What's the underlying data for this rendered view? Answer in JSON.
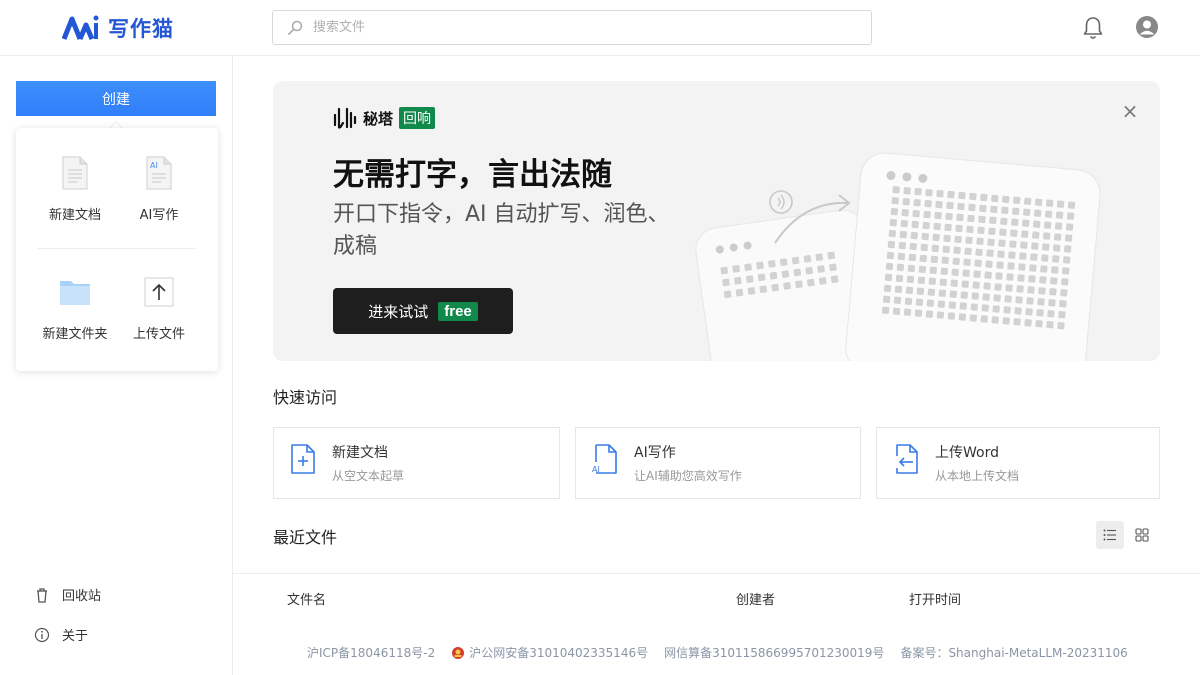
{
  "header": {
    "logo_text": "写作猫",
    "search_placeholder": "搜索文件",
    "icons": [
      "bell-icon",
      "user-icon"
    ]
  },
  "sidebar": {
    "create_label": "创建",
    "create_menu": [
      {
        "label": "新建文档",
        "icon": "document-icon"
      },
      {
        "label": "AI写作",
        "icon": "ai-document-icon"
      },
      {
        "label": "新建文件夹",
        "icon": "folder-icon"
      },
      {
        "label": "上传文件",
        "icon": "upload-icon"
      }
    ],
    "bottom": [
      {
        "label": "回收站",
        "icon": "trash-icon"
      },
      {
        "label": "关于",
        "icon": "info-icon"
      }
    ]
  },
  "banner": {
    "brand_name": "秘塔",
    "brand_tag": "回响",
    "title": "无需打字，言出法随",
    "subtitle": "开口下指令，AI 自动扩写、润色、成稿",
    "button_label": "进来试试",
    "button_tag": "free",
    "colors": {
      "tag_green": "#10894b",
      "button_bg": "#1e1e1e",
      "banner_bg": "#f3f3f3"
    }
  },
  "quick_access": {
    "title": "快速访问",
    "cards": [
      {
        "title": "新建文档",
        "desc": "从空文本起草",
        "icon": "new-document-icon"
      },
      {
        "title": "AI写作",
        "desc": "让AI辅助您高效写作",
        "icon": "ai-document-icon"
      },
      {
        "title": "上传Word",
        "desc": "从本地上传文档",
        "icon": "upload-word-icon"
      }
    ]
  },
  "recent": {
    "title": "最近文件",
    "columns": [
      "文件名",
      "创建者",
      "打开时间"
    ],
    "view_modes": [
      "list-view-icon",
      "grid-view-icon"
    ]
  },
  "footer": {
    "icp": "沪ICP备18046118号-2",
    "police": "沪公网安备31010402335146号",
    "net_info": "网信算备310115866995701230019号",
    "record": "备案号：Shanghai-MetaLLM-20231106"
  },
  "colors": {
    "primary_blue": "#2f7ef8",
    "logo_blue": "#2457d6",
    "footer_text": "#8a96a6"
  }
}
